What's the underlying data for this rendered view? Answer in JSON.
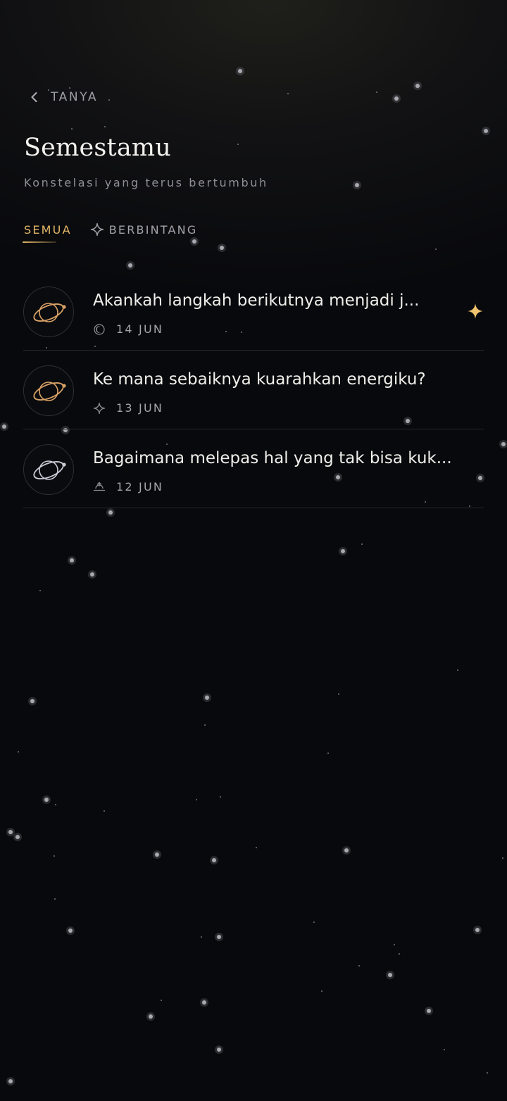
{
  "header": {
    "back_label": "TANYA",
    "title": "Semestamu",
    "subtitle": "Konstelasi yang terus bertumbuh"
  },
  "tabs": [
    {
      "label": "SEMUA",
      "active": true
    },
    {
      "label": "BERBINTANG",
      "active": false,
      "icon": "star-outline-icon"
    }
  ],
  "entries": [
    {
      "question": "Akankah langkah berikutnya menjadi j...",
      "date": "14 JUN",
      "meta_icon": "moon-icon",
      "planet_color": "#d9a267",
      "starred": true
    },
    {
      "question": "Ke mana sebaiknya kuarahkan energiku?",
      "date": "13 JUN",
      "meta_icon": "sparkle-icon",
      "planet_color": "#d9a267",
      "starred": false
    },
    {
      "question": "Bagaimana melepas hal yang tak bisa kuk...",
      "date": "12 JUN",
      "meta_icon": "sunrise-icon",
      "planet_color": "#c9ccd6",
      "starred": false
    }
  ],
  "colors": {
    "accent": "#e3b768",
    "text": "#efeeea",
    "muted": "#a4a4ac",
    "background": "#07080b",
    "divider": "#26272b"
  }
}
